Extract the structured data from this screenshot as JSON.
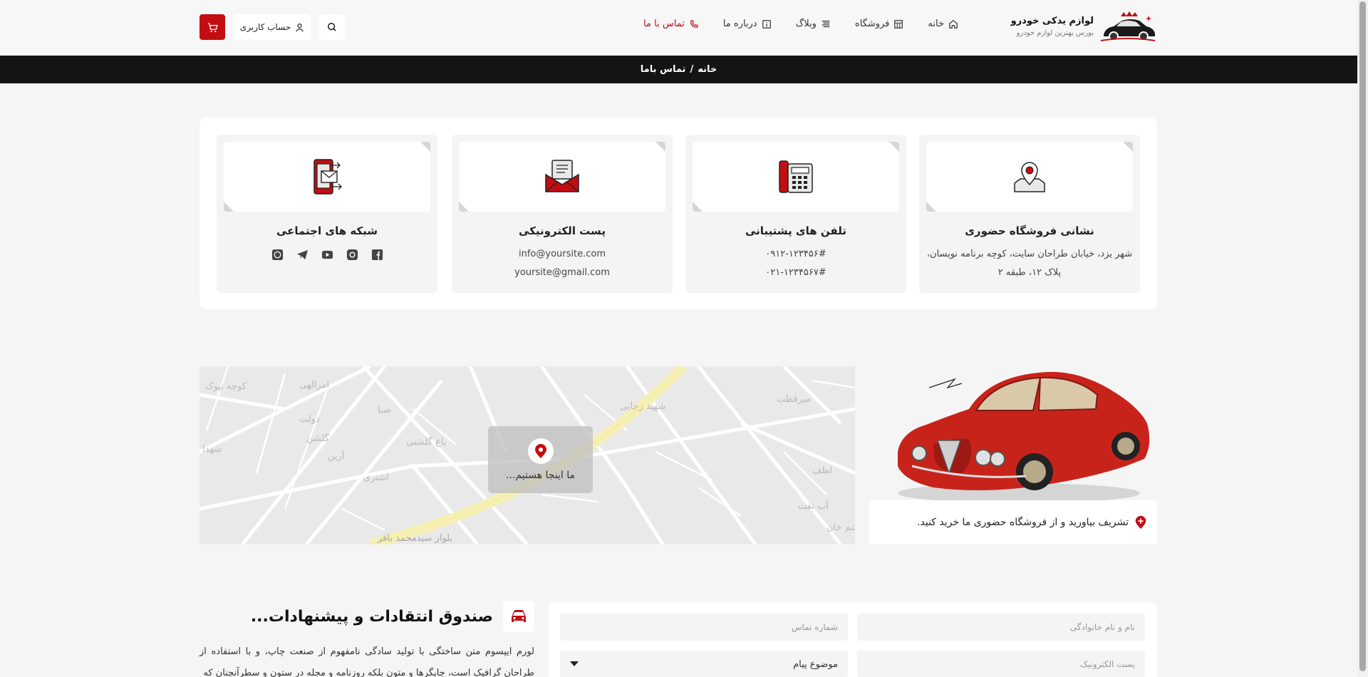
{
  "header": {
    "logo_title": "لوازم یدکی خودرو",
    "logo_subtitle": "بورس بهترین لوازم خودرو",
    "nav": [
      {
        "label": "خانه",
        "icon": "home-icon"
      },
      {
        "label": "فروشگاه",
        "icon": "shop-icon"
      },
      {
        "label": "وبلاگ",
        "icon": "blog-icon"
      },
      {
        "label": "درباره ما",
        "icon": "info-icon"
      },
      {
        "label": "تماس با ما",
        "icon": "phone-icon",
        "active": true
      }
    ],
    "account_label": "حساب کاربری",
    "accent_color": "#c30d13"
  },
  "breadcrumb": {
    "home": "خانه",
    "separator": "/",
    "current": "تماس باما"
  },
  "contact_cards": [
    {
      "title": "نشانی فروشگاه حضوری",
      "lines": [
        "شهر یزد، خیابان طراحان سایت، کوچه برنامه نویسان،",
        "پلاک ۱۲، طبقه ۲"
      ],
      "icon": "map-location-icon"
    },
    {
      "title": "تلفن های پشتیبانی",
      "lines": [
        "۰۹۱۲-۱۲۳۴۵۶#",
        "۰۲۱-۱۲۳۴۵۶۷#"
      ],
      "icon": "telephone-icon"
    },
    {
      "title": "پست الکترونیکی",
      "lines": [
        "info@yoursite.com",
        "yoursite@gmail.com"
      ],
      "icon": "envelope-icon"
    },
    {
      "title": "شبکه های اجتماعی",
      "icon": "social-phone-icon",
      "socials": [
        "facebook-icon",
        "instagram-icon",
        "youtube-icon",
        "telegram-icon",
        "whatsapp-icon"
      ]
    }
  ],
  "map": {
    "pin_label": "ما اینجا هستیم...",
    "street_labels": [
      "کوچه نیوک",
      "امرالهی",
      "دولت",
      "گلشن",
      "صبا",
      "باغ گلشنی",
      "آرین",
      "اشتری",
      "شهید رجایی",
      "میرقطب",
      "بلوار سیدمحمد باقر",
      "آب نفت",
      "هاشم خان",
      "لطف",
      "شهدا"
    ]
  },
  "store_caption": "تشریف بیاورید و از فروشگاه حضوری ما خرید کنید.",
  "feedback": {
    "title": "صندوق انتقادات و پیشنهادات...",
    "text": "لورم ایپسوم متن ساختگی با تولید سادگی نامفهوم از صنعت چاپ، و با استفاده از طراحان گرافیک است، چاپگرها و متون بلکه روزنامه و مجله در ستون و سطرآنچنان که"
  },
  "form": {
    "name_placeholder": "نام و نام خانوادگی",
    "phone_placeholder": "شماره تماس",
    "email_placeholder": "پست الکترونیک",
    "subject_value": "موضوع پیام"
  }
}
